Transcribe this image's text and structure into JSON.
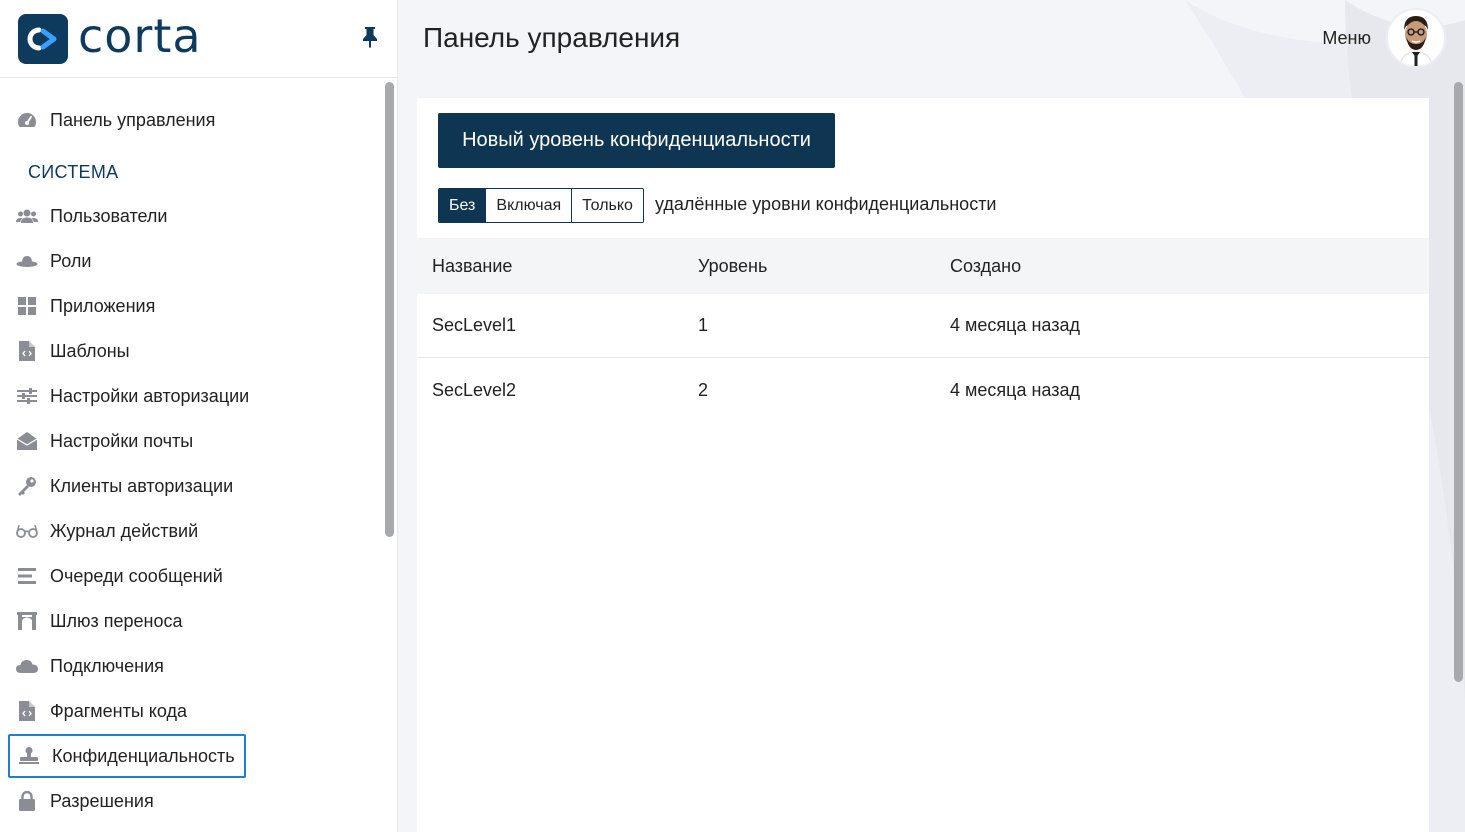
{
  "brand": {
    "name": "corta",
    "color": "#0e3a5e"
  },
  "sidebar": {
    "dashboard": {
      "label": "Панель управления",
      "icon": "dashboard-gauge-icon"
    },
    "section_title": "СИСТЕМА",
    "items": [
      {
        "label": "Пользователи",
        "icon": "users-icon"
      },
      {
        "label": "Роли",
        "icon": "hat-icon"
      },
      {
        "label": "Приложения",
        "icon": "apps-grid-icon"
      },
      {
        "label": "Шаблоны",
        "icon": "code-file-icon"
      },
      {
        "label": "Настройки авторизации",
        "icon": "sliders-icon"
      },
      {
        "label": "Настройки почты",
        "icon": "mail-open-icon"
      },
      {
        "label": "Клиенты авторизации",
        "icon": "key-icon"
      },
      {
        "label": "Журнал действий",
        "icon": "glasses-icon"
      },
      {
        "label": "Очереди сообщений",
        "icon": "list-lines-icon"
      },
      {
        "label": "Шлюз переноса",
        "icon": "gateway-icon"
      },
      {
        "label": "Подключения",
        "icon": "cloud-icon"
      },
      {
        "label": "Фрагменты кода",
        "icon": "code-file-icon"
      },
      {
        "label": "Конфиденциальность",
        "icon": "stamp-icon",
        "active": true
      },
      {
        "label": "Разрешения",
        "icon": "lock-icon"
      }
    ]
  },
  "header": {
    "title": "Панель управления",
    "menu_label": "Меню"
  },
  "content": {
    "new_button_label": "Новый уровень конфиденциальности",
    "filter": {
      "options": [
        "Без",
        "Включая",
        "Только"
      ],
      "selected": "Без",
      "suffix": "удалённые уровни конфиденциальности"
    },
    "table": {
      "columns": [
        "Название",
        "Уровень",
        "Создано"
      ],
      "rows": [
        {
          "name": "SecLevel1",
          "level": "1",
          "created": "4 месяца назад"
        },
        {
          "name": "SecLevel2",
          "level": "2",
          "created": "4 месяца назад"
        }
      ]
    }
  },
  "colors": {
    "primary": "#0e3552",
    "active_outline": "#1f7fd6",
    "icon_gray": "#8a8d93"
  }
}
